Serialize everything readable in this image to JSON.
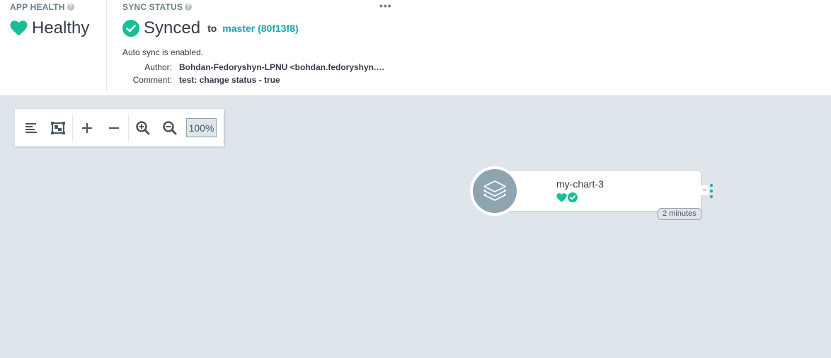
{
  "app_health": {
    "title": "APP HEALTH",
    "help_glyph": "?",
    "status": "Healthy",
    "icon": "heart-icon",
    "color": "#18be94"
  },
  "sync_status": {
    "title": "SYNC STATUS",
    "help_glyph": "?",
    "status": "Synced",
    "icon": "check-circle-icon",
    "color": "#18be94",
    "to_label": "to",
    "revision": "master (80f13f8)",
    "more_glyph": "•••",
    "auto_sync": "Auto sync is enabled.",
    "author_label": "Author:",
    "author_value": "Bohdan-Fedoryshyn-LPNU <bohdan.fedoryshyn.mitp…",
    "comment_label": "Comment:",
    "comment_value": "test: change status - true"
  },
  "toolbar": {
    "zoom_level": "100%",
    "buttons": [
      "align-left-icon",
      "fit-view-icon",
      "plus-icon",
      "minus-icon",
      "zoom-in-icon",
      "zoom-out-icon"
    ]
  },
  "node": {
    "name": "my-chart-3",
    "icon": "layers-icon",
    "health_icon": "heart-icon",
    "sync_icon": "check-circle-icon",
    "age": "2 minutes",
    "collapse_glyph": "−"
  },
  "colors": {
    "accent": "#1aa3b6",
    "success": "#18be94",
    "canvas": "#dee6eb",
    "node_icon_bg": "#8fa4b1"
  }
}
